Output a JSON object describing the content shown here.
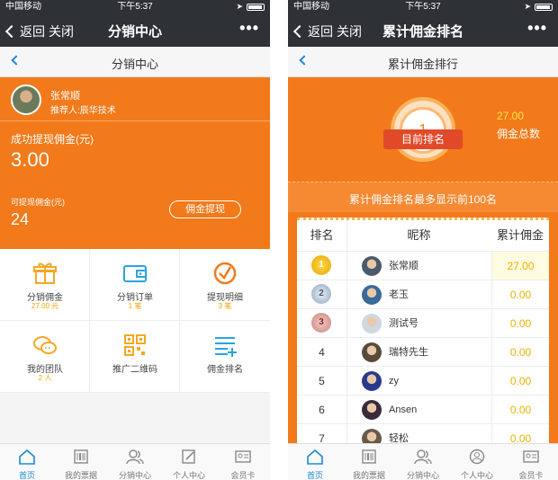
{
  "status": {
    "carrier": "中国移动",
    "time": "下午5:37"
  },
  "wechat": {
    "back": "返回",
    "close": "关闭",
    "more": "•••"
  },
  "left": {
    "nav_title": "分销中心",
    "page_title": "分销中心",
    "user": {
      "name": "张常顺",
      "referrer": "推荐人:辰华技术"
    },
    "withdrawn_label": "成功提现佣金(元)",
    "withdrawn_value": "3.00",
    "available_label": "可提现佣金(元)",
    "available_value": "24",
    "withdraw_button": "佣金提现",
    "grid": [
      {
        "label": "分销佣金",
        "count": "27.00 元",
        "icon": "gift-icon"
      },
      {
        "label": "分销订单",
        "count": "1 笔",
        "icon": "wallet-icon"
      },
      {
        "label": "提现明细",
        "count": "3 笔",
        "icon": "clock-icon"
      },
      {
        "label": "我的团队",
        "count": "2 人",
        "icon": "chat-icon"
      },
      {
        "label": "推广二维码",
        "count": "",
        "icon": "qrcode-icon"
      },
      {
        "label": "佣金排名",
        "count": "",
        "icon": "list-icon"
      }
    ]
  },
  "right": {
    "nav_title": "累计佣金排名",
    "page_title": "累计佣金排行",
    "my_rank": "1",
    "my_rank_label": "目前排名",
    "total": "27.00",
    "total_label": "佣金总数",
    "banner": "累计佣金排名最多显示前100名",
    "table": {
      "headers": [
        "排名",
        "昵称",
        "累计佣金"
      ],
      "rows": [
        {
          "rank": "1",
          "medal": "gold",
          "name": "张常顺",
          "amount": "27.00"
        },
        {
          "rank": "2",
          "medal": "silver",
          "name": "老玉",
          "amount": "0.00"
        },
        {
          "rank": "3",
          "medal": "bronze",
          "name": "测试号",
          "amount": "0.00"
        },
        {
          "rank": "4",
          "medal": "",
          "name": "瑞特先生",
          "amount": "0.00"
        },
        {
          "rank": "5",
          "medal": "",
          "name": "zy",
          "amount": "0.00"
        },
        {
          "rank": "6",
          "medal": "",
          "name": "Ansen",
          "amount": "0.00"
        },
        {
          "rank": "7",
          "medal": "",
          "name": "轻松",
          "amount": "0.00"
        }
      ]
    }
  },
  "tabs": [
    "首页",
    "我的票据",
    "分销中心",
    "个人中心",
    "会员卡"
  ],
  "colors": {
    "orange": "#f27a1a",
    "accent_blue": "#1a8ad4",
    "amount_gold": "#e8b100"
  }
}
